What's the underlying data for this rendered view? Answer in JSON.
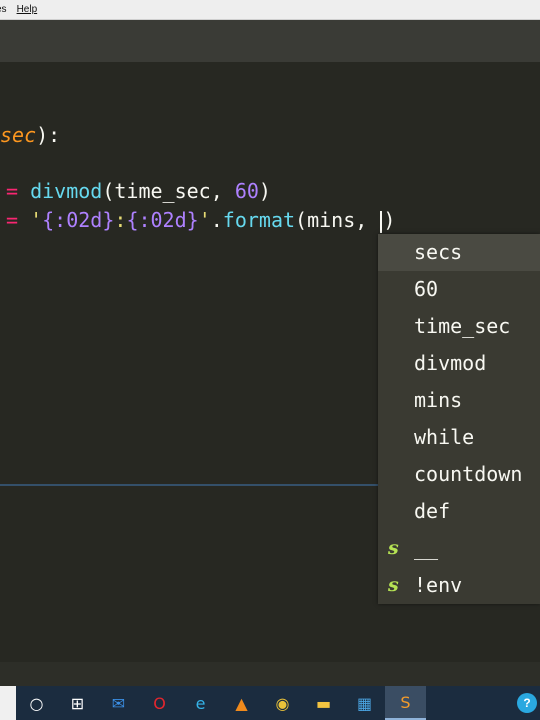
{
  "menu": {
    "items": [
      "es",
      "Help"
    ]
  },
  "editor": {
    "line1": {
      "param": "sec",
      "rest": "):"
    },
    "line2": {
      "op": "=",
      "fn": "divmod",
      "open": "(",
      "arg": "time_sec, ",
      "num": "60",
      "close": ")"
    },
    "line3": {
      "op": "=",
      "q1": "'",
      "ph1": "{:02d}",
      "colon": ":",
      "ph2": "{:02d}",
      "q2": "'",
      "dot": ".",
      "method": "format",
      "open": "(",
      "args": "mins, ",
      "close": ")"
    }
  },
  "autocomplete": {
    "items": [
      {
        "label": "secs",
        "kind": ""
      },
      {
        "label": "60",
        "kind": ""
      },
      {
        "label": "time_sec",
        "kind": ""
      },
      {
        "label": "divmod",
        "kind": ""
      },
      {
        "label": "mins",
        "kind": ""
      },
      {
        "label": "while",
        "kind": ""
      },
      {
        "label": "countdown",
        "kind": ""
      },
      {
        "label": "def",
        "kind": ""
      },
      {
        "label": "__",
        "kind": "s"
      },
      {
        "label": "!env",
        "kind": "s"
      }
    ]
  },
  "taskbar": {
    "icons": [
      {
        "name": "cortana-icon",
        "glyph": "○",
        "color": "#ffffff"
      },
      {
        "name": "task-view-icon",
        "glyph": "⊞",
        "color": "#ffffff"
      },
      {
        "name": "mail-icon",
        "glyph": "✉",
        "color": "#3b8fe6"
      },
      {
        "name": "opera-icon",
        "glyph": "O",
        "color": "#e3262e"
      },
      {
        "name": "edge-icon",
        "glyph": "e",
        "color": "#35b3e8"
      },
      {
        "name": "vlc-icon",
        "glyph": "▲",
        "color": "#f08a1c"
      },
      {
        "name": "chrome-icon",
        "glyph": "◉",
        "color": "#e9c23a"
      },
      {
        "name": "file-explorer-icon",
        "glyph": "▬",
        "color": "#f3c441"
      },
      {
        "name": "calculator-icon",
        "glyph": "▦",
        "color": "#4aa3e0"
      },
      {
        "name": "sublime-text-icon",
        "glyph": "S",
        "color": "#f59c2a"
      }
    ],
    "active_index": 9,
    "help_glyph": "?",
    "help_color": "#2aa8e0"
  },
  "colors": {
    "background": "#272822",
    "keyword": "#f92672",
    "function": "#66d9ef",
    "number": "#ae81ff",
    "string": "#e6db74",
    "snippet_marker": "#b6e354"
  }
}
